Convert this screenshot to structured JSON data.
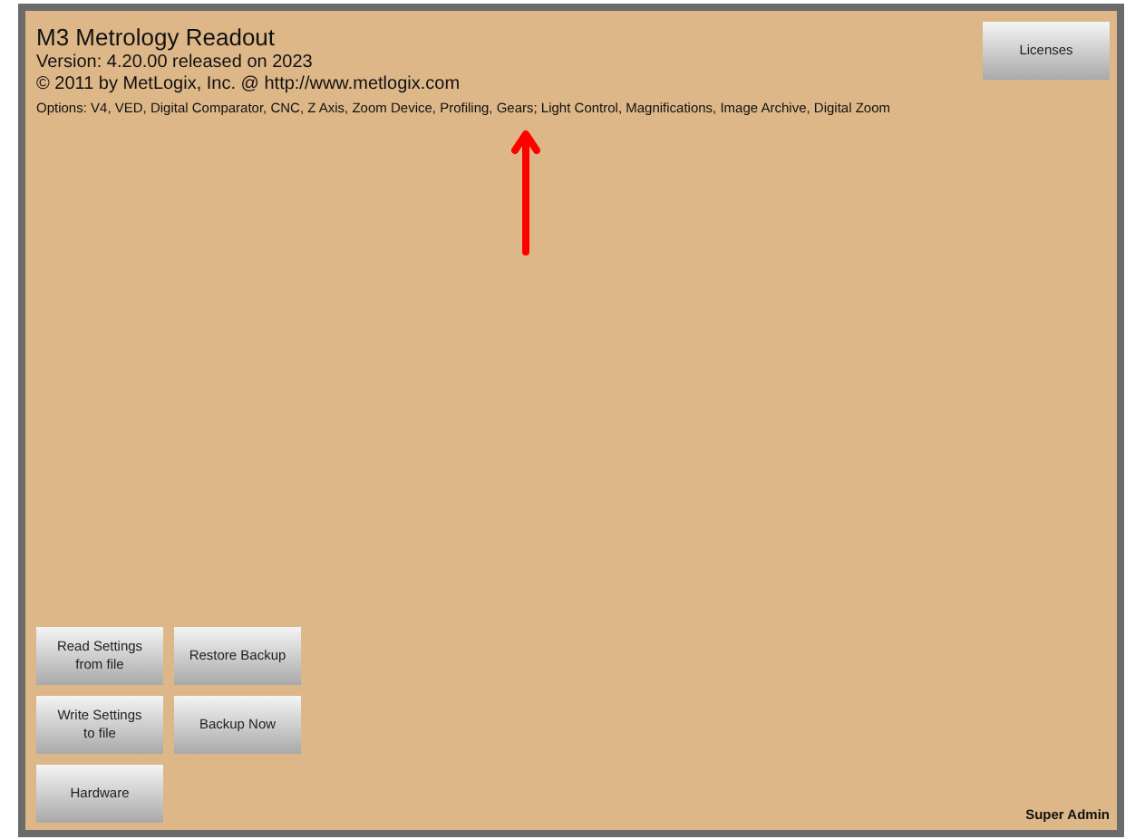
{
  "header": {
    "title": "M3 Metrology Readout",
    "version": "Version: 4.20.00 released on 2023",
    "copyright": "© 2011 by MetLogix, Inc. @ http://www.metlogix.com",
    "options": "Options: V4, VED, Digital Comparator, CNC, Z Axis, Zoom Device, Profiling, Gears; Light Control, Magnifications, Image Archive, Digital Zoom"
  },
  "licenses_button": "Licenses",
  "buttons": [
    {
      "label": "Read Settings\nfrom file"
    },
    {
      "label": "Restore Backup"
    },
    {
      "label": "Write Settings\nto file"
    },
    {
      "label": "Backup Now"
    },
    {
      "label": "Hardware"
    }
  ],
  "user": "Super Admin"
}
